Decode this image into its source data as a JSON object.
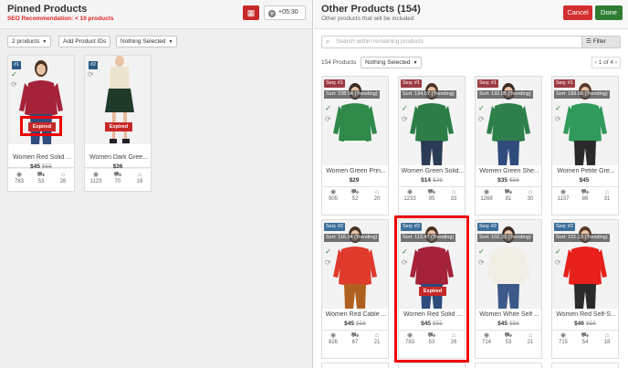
{
  "pinned": {
    "title": "Pinned Products",
    "recommendation": "SEO Recommendation: < 10 products",
    "timezone": "+05:30",
    "chips": [
      "2 products",
      "Add Product IDs",
      "Nothing Selected"
    ],
    "cards": [
      {
        "badge": "#1",
        "expired_label": "Expired",
        "name": "Women Red Solid ...",
        "price": "$45",
        "old_price": "$55",
        "views": "783",
        "carts": "53",
        "orders": "26"
      },
      {
        "badge": "#2",
        "expired_label": "Expired",
        "name": "Women Dark Gree...",
        "price": "$36",
        "old_price": "",
        "views": "1123",
        "carts": "70",
        "orders": "19"
      }
    ]
  },
  "other": {
    "title": "Other Products (154)",
    "subtitle": "Other products that will be included",
    "cancel": "Cancel",
    "done": "Done",
    "search_placeholder": "Search within remaining products",
    "filter": "Filter",
    "count": "154 Products",
    "select": "Nothing Selected",
    "pager": "1 of 4",
    "cards": [
      {
        "seq": "Seq: #1",
        "sort": "Sort: 238.54 (Trending)",
        "name": "Women Green Prin...",
        "price": "$29",
        "old_price": "",
        "views": "905",
        "carts": "52",
        "orders": "20"
      },
      {
        "seq": "Seq: #1",
        "sort": "Sort: 194.57 (Trending)",
        "name": "Women Green Solid...",
        "price": "$14",
        "old_price": "$26",
        "views": "1233",
        "carts": "95",
        "orders": "33"
      },
      {
        "seq": "Seq: #1",
        "sort": "Sort: 192.85 (Trending)",
        "name": "Women Green She...",
        "price": "$35",
        "old_price": "$56",
        "views": "1268",
        "carts": "81",
        "orders": "30"
      },
      {
        "seq": "Seq: #1",
        "sort": "Sort: 189.66 (Trending)",
        "name": "Women Petite Gre...",
        "price": "$45",
        "old_price": "",
        "views": "1137",
        "carts": "86",
        "orders": "31"
      },
      {
        "seq": "Seq: #2",
        "sort": "Sort: 116.34 (Trending)",
        "name": "Women Red Cable ...",
        "price": "$45",
        "old_price": "$56",
        "views": "826",
        "carts": "67",
        "orders": "21"
      },
      {
        "seq": "Seq: #2",
        "sort": "Sort: 113.47 (Trending)",
        "expired_label": "Expired",
        "name": "Women Red Solid ...",
        "price": "$45",
        "old_price": "$55",
        "views": "783",
        "carts": "53",
        "orders": "26"
      },
      {
        "seq": "Seq: #2",
        "sort": "Sort: 102.33 (Trending)",
        "name": "Women White Self ...",
        "price": "$45",
        "old_price": "$56",
        "views": "714",
        "carts": "53",
        "orders": "21"
      },
      {
        "seq": "Seq: #2",
        "sort": "Sort: 101.13 (Trending)",
        "name": "Women Red Self-S...",
        "price": "$46",
        "old_price": "$56",
        "views": "715",
        "carts": "54",
        "orders": "18"
      }
    ]
  },
  "colors": {
    "danger": "#d32f2f",
    "success": "#2e7d32",
    "seq_red": "#9e3a44",
    "seq_blue": "#3d6f9a",
    "highlight": "#ee0000"
  }
}
